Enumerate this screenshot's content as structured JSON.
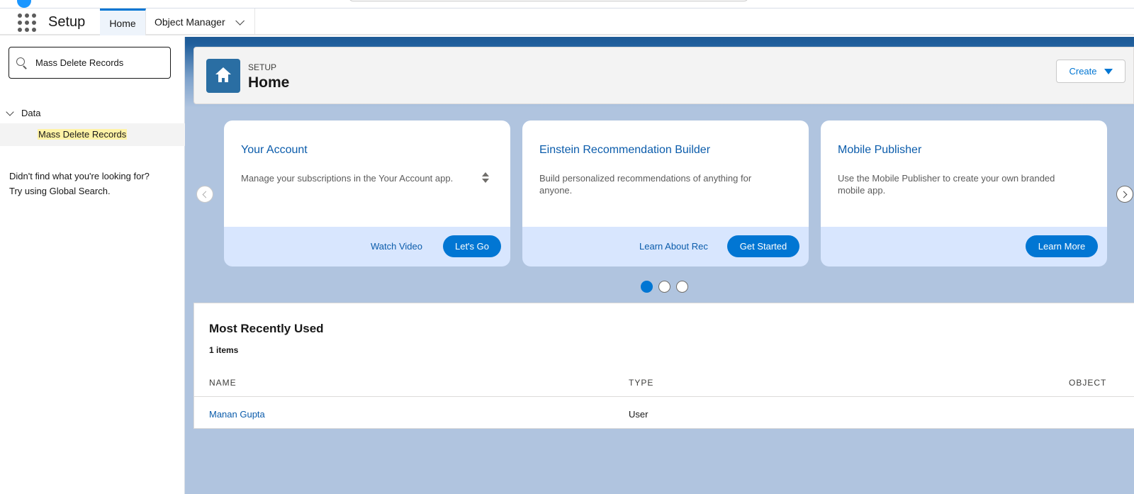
{
  "app": {
    "name": "Setup",
    "tabs": [
      {
        "label": "Home",
        "active": true
      },
      {
        "label": "Object Manager",
        "active": false
      }
    ]
  },
  "sidebar": {
    "search_value": "Mass Delete Records",
    "tree": {
      "group_label": "Data",
      "item_label": "Mass Delete Records"
    },
    "not_found_line1": "Didn't find what you're looking for?",
    "not_found_line2": "Try using Global Search."
  },
  "header": {
    "breadcrumb": "SETUP",
    "title": "Home",
    "create_label": "Create"
  },
  "cards": [
    {
      "title": "Your Account",
      "description": "Manage your subscriptions in the Your Account app.",
      "link_label": "Watch Video",
      "button_label": "Let's Go"
    },
    {
      "title": "Einstein Recommendation Builder",
      "description": "Build personalized recommendations of anything for anyone.",
      "link_label": "Learn About Rec",
      "button_label": "Get Started"
    },
    {
      "title": "Mobile Publisher",
      "description": "Use the Mobile Publisher to create your own branded mobile app.",
      "button_label": "Learn More"
    }
  ],
  "carousel": {
    "active_index": 0,
    "total": 3
  },
  "mru": {
    "title": "Most Recently Used",
    "count": "1 items",
    "columns": [
      "NAME",
      "TYPE",
      "OBJECT"
    ],
    "rows": [
      {
        "name": "Manan Gupta",
        "type": "User",
        "object": ""
      }
    ]
  },
  "colors": {
    "brand_blue": "#0176d3",
    "link_blue": "#0b5cab",
    "background_blue": "#b0c4df",
    "highlight_yellow": "#fff3a6"
  }
}
